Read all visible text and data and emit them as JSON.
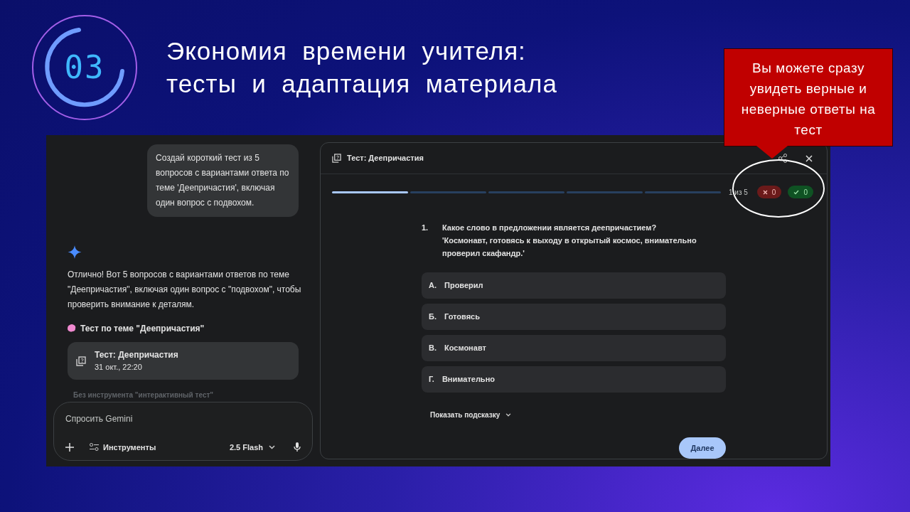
{
  "slide": {
    "step_number": "03",
    "title_lines": [
      "Экономия  времени  учителя:",
      "тесты  и  адаптация  материала"
    ],
    "callout": "Вы  можете  сразу увидеть  верные  и неверные  ответы на  тест"
  },
  "chat": {
    "user_message": "Создай короткий тест из 5 вопросов с вариантами ответа по теме 'Деепричастия', включая один вопрос с подвохом.",
    "response": "Отлично! Вот 5 вопросов с вариантами ответов по теме \"Деепричастия\", включая один вопрос с \"подвохом\", чтобы проверить внимание к деталям.",
    "quiz_heading": "Тест по теме \"Деепричастия\"",
    "quiz_card": {
      "title": "Тест: Деепричастия",
      "date": "31 окт., 22:20"
    },
    "note": "Без инструмента \"интерактивный тест\"",
    "input": {
      "placeholder": "Спросить Gemini"
    },
    "tools_label": "Инструменты",
    "model": "2.5 Flash"
  },
  "quiz": {
    "title": "Тест: Деепричастия",
    "steps": [
      {
        "selected": true
      },
      {
        "selected": false
      },
      {
        "selected": false
      },
      {
        "selected": false
      },
      {
        "selected": false
      }
    ],
    "counter": "1 из 5",
    "wrong_count": "0",
    "correct_count": "0",
    "question_number": "1.",
    "question": "Какое слово в предложении является деепричастием?",
    "quote": "'Космонавт, готовясь к выходу в открытый космос, внимательно проверил скафандр.'",
    "options": [
      {
        "letter": "А.",
        "text": "Проверил",
        "selected": false
      },
      {
        "letter": "Б.",
        "text": "Готовясь",
        "selected": false
      },
      {
        "letter": "В.",
        "text": "Космонавт",
        "selected": false
      },
      {
        "letter": "Г.",
        "text": "Внимательно",
        "selected": false
      }
    ],
    "hint": "Показать подсказку",
    "next": "Далее"
  }
}
